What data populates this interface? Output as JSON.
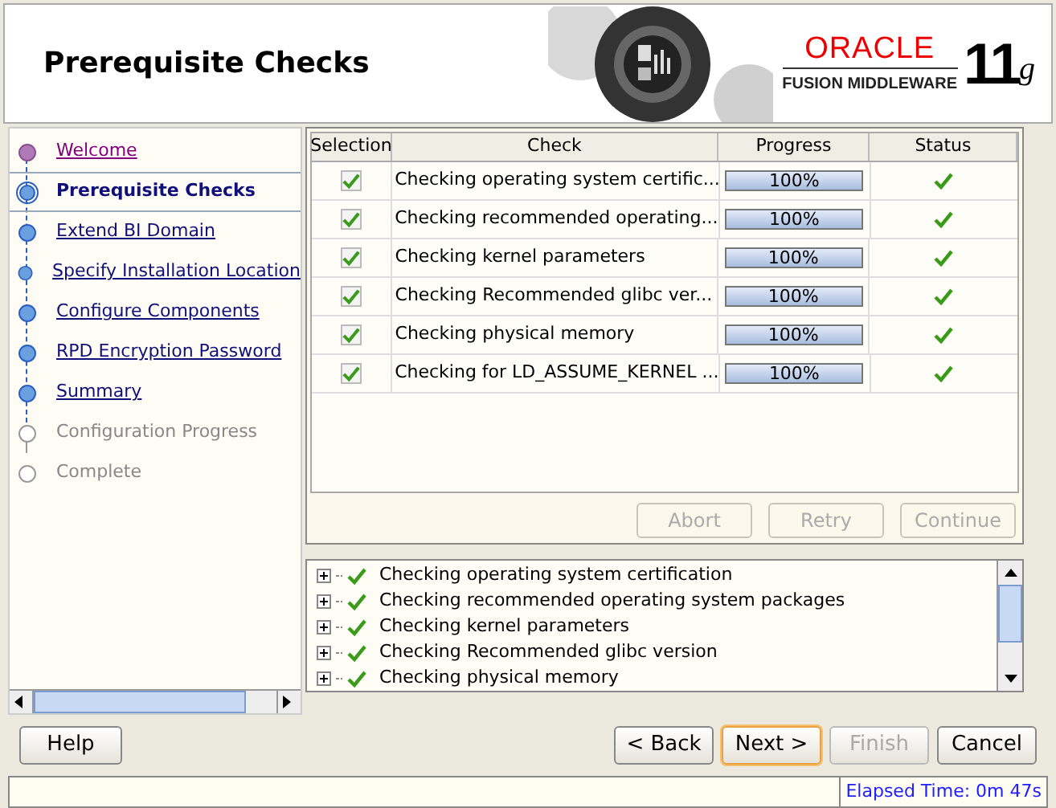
{
  "header": {
    "title": "Prerequisite Checks",
    "logo": {
      "brand": "ORACLE",
      "product": "FUSION MIDDLEWARE",
      "version": "11",
      "version_suffix": "g"
    }
  },
  "steps": [
    {
      "label": "Welcome",
      "visited": true,
      "selected": false,
      "disabled": false
    },
    {
      "label": "Prerequisite Checks",
      "visited": false,
      "selected": true,
      "disabled": false
    },
    {
      "label": "Extend BI Domain",
      "visited": false,
      "selected": false,
      "disabled": false
    },
    {
      "label": "Specify Installation Location",
      "visited": false,
      "selected": false,
      "disabled": false
    },
    {
      "label": "Configure Components",
      "visited": false,
      "selected": false,
      "disabled": false
    },
    {
      "label": "RPD Encryption Password",
      "visited": false,
      "selected": false,
      "disabled": false
    },
    {
      "label": "Summary",
      "visited": false,
      "selected": false,
      "disabled": false
    },
    {
      "label": "Configuration Progress",
      "visited": false,
      "selected": false,
      "disabled": true
    },
    {
      "label": "Complete",
      "visited": false,
      "selected": false,
      "disabled": true
    }
  ],
  "table": {
    "columns": [
      "Selection",
      "Check",
      "Progress",
      "Status"
    ],
    "rows": [
      {
        "checked": true,
        "check": "Checking operating system certific...",
        "level": 1,
        "reading": "100%",
        "passed": true
      },
      {
        "checked": true,
        "check": "Checking recommended operating...",
        "level": 1,
        "reading": "100%",
        "passed": true
      },
      {
        "checked": true,
        "check": "Checking kernel parameters",
        "level": 1,
        "reading": "100%",
        "passed": true
      },
      {
        "checked": true,
        "check": "Checking Recommended glibc ver...",
        "level": 1,
        "reading": "100%",
        "passed": true
      },
      {
        "checked": true,
        "check": "Checking physical memory",
        "level": 1,
        "reading": "100%",
        "passed": true
      },
      {
        "checked": true,
        "check": "Checking for LD_ASSUME_KERNEL ...",
        "level": 1,
        "reading": "100%",
        "passed": true
      }
    ]
  },
  "check_actions": [
    {
      "label": "Abort",
      "disabled": true
    },
    {
      "label": "Retry",
      "disabled": true
    },
    {
      "label": "Continue",
      "disabled": true
    }
  ],
  "details": [
    {
      "label": "Checking operating system certification",
      "expanded": false,
      "passed": true
    },
    {
      "label": "Checking recommended operating system packages",
      "expanded": false,
      "passed": true
    },
    {
      "label": "Checking kernel parameters",
      "expanded": false,
      "passed": true
    },
    {
      "label": "Checking Recommended glibc version",
      "expanded": false,
      "passed": true
    },
    {
      "label": "Checking physical memory",
      "expanded": false,
      "passed": true
    }
  ],
  "help_button": {
    "label": "Help",
    "disabled": false
  },
  "nav_buttons": [
    {
      "label": "< Back",
      "disabled": false,
      "default": false
    },
    {
      "label": "Next >",
      "disabled": false,
      "default": true
    },
    {
      "label": "Finish",
      "disabled": true,
      "default": false
    },
    {
      "label": "Cancel",
      "disabled": false,
      "default": false
    }
  ],
  "status_bar": {
    "elapsed": "Elapsed Time: 0m 47s"
  }
}
